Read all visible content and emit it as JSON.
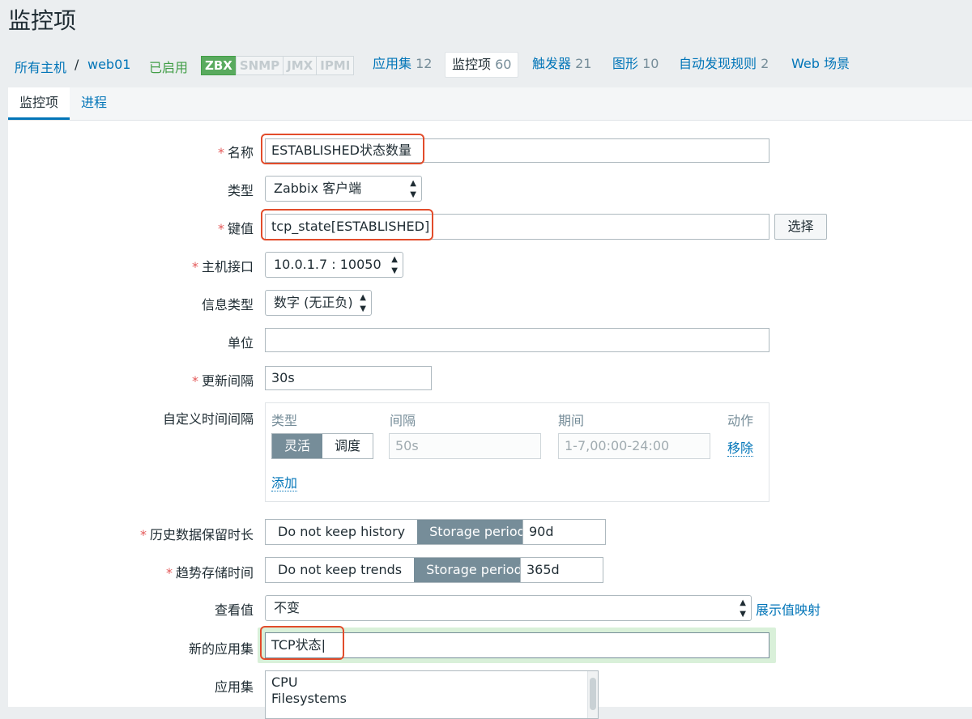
{
  "page_title": "监控项",
  "breadcrumb": {
    "all_hosts": "所有主机",
    "separator": "/",
    "host": "web01",
    "status": "已启用"
  },
  "availability": {
    "zbx": "ZBX",
    "snmp": "SNMP",
    "jmx": "JMX",
    "ipmi": "IPMI"
  },
  "host_tabs": [
    {
      "label": "应用集",
      "count": "12"
    },
    {
      "label": "监控项",
      "count": "60"
    },
    {
      "label": "触发器",
      "count": "21"
    },
    {
      "label": "图形",
      "count": "10"
    },
    {
      "label": "自动发现规则",
      "count": "2"
    },
    {
      "label": "Web 场景",
      "count": ""
    }
  ],
  "sub_tabs": [
    "监控项",
    "进程"
  ],
  "form": {
    "name": {
      "label": "名称",
      "value": "ESTABLISHED状态数量"
    },
    "type": {
      "label": "类型",
      "value": "Zabbix 客户端"
    },
    "key": {
      "label": "键值",
      "value": "tcp_state[ESTABLISHED]",
      "button": "选择"
    },
    "interface": {
      "label": "主机接口",
      "value": "10.0.1.7 : 10050"
    },
    "info_type": {
      "label": "信息类型",
      "value": "数字 (无正负)"
    },
    "units": {
      "label": "单位",
      "value": ""
    },
    "update_interval": {
      "label": "更新间隔",
      "value": "30s"
    },
    "custom_intervals": {
      "label": "自定义时间间隔",
      "col_type": "类型",
      "col_interval": "间隔",
      "col_period": "期间",
      "col_action": "动作",
      "flexible": "灵活",
      "scheduling": "调度",
      "interval_placeholder": "50s",
      "period_placeholder": "1-7,00:00-24:00",
      "remove": "移除",
      "add": "添加"
    },
    "history": {
      "label": "历史数据保留时长",
      "off": "Do not keep history",
      "on": "Storage period",
      "value": "90d"
    },
    "trends": {
      "label": "趋势存储时间",
      "off": "Do not keep trends",
      "on": "Storage period",
      "value": "365d"
    },
    "show_value": {
      "label": "查看值",
      "value": "不变",
      "link": "展示值映射"
    },
    "new_application": {
      "label": "新的应用集",
      "value": "TCP状态"
    },
    "applications": {
      "label": "应用集",
      "items": [
        "CPU",
        "Filesystems"
      ]
    }
  },
  "colors": {
    "link": "#0275b8",
    "enabled_green": "#429e47",
    "zbx_badge": "#59aa5e",
    "segment_active": "#768d99",
    "required": "#e45959",
    "highlight_box": "#e24c2b"
  },
  "icons": {
    "select_arrow": "up-down-arrow-icon"
  }
}
